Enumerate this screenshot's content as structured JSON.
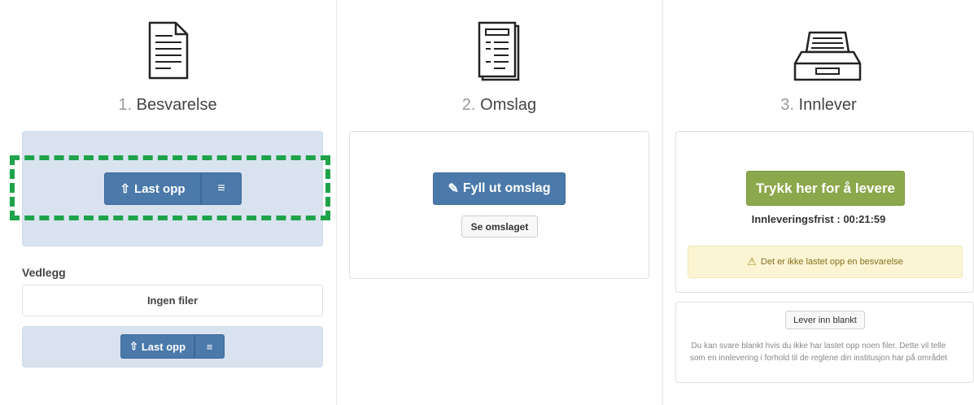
{
  "steps": [
    {
      "number": "1.",
      "title": "Besvarelse"
    },
    {
      "number": "2.",
      "title": "Omslag"
    },
    {
      "number": "3.",
      "title": "Innlever"
    }
  ],
  "besvarelse": {
    "upload_label": "Last opp",
    "menu_icon": "hamburger-icon"
  },
  "vedlegg": {
    "heading": "Vedlegg",
    "empty_text": "Ingen filer",
    "upload_label": "Last opp"
  },
  "omslag": {
    "fill_label": "Fyll ut omslag",
    "view_label": "Se omslaget"
  },
  "innlever": {
    "submit_label": "Trykk her for å levere",
    "deadline_text": "Innleveringsfrist : 00:21:59",
    "warning_text": "Det er ikke lastet opp en besvarelse",
    "blank_button_label": "Lever inn blankt",
    "blank_info": "Du kan svare blankt hvis du ikke har lastet opp noen filer. Dette vil telle som en innlevering i forhold til de reglene din institusjon har på området"
  },
  "colors": {
    "primary": "#4a79aa",
    "success": "#8ca84c",
    "highlight_dashed": "#1fa34a",
    "panel_blue": "#d9e3f0",
    "warning_bg": "#fbf5d4"
  }
}
